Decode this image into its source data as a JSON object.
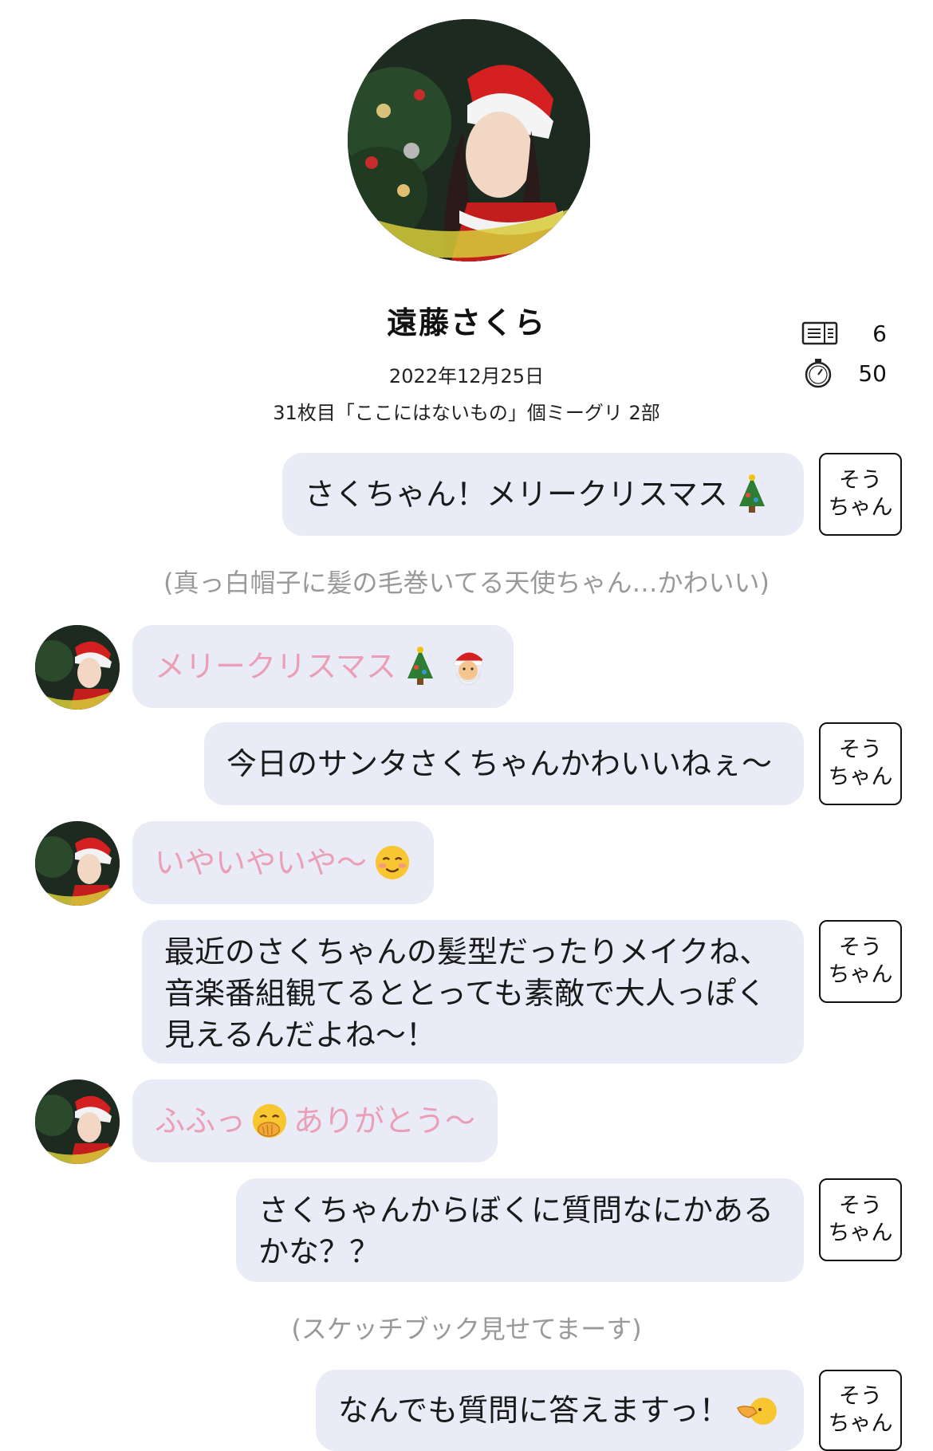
{
  "header": {
    "name": "遠藤さくら",
    "date": "2022年12月25日",
    "event": "31枚目「ここにはないもの」個ミーグリ 2部",
    "stats": [
      {
        "icon": "ticket-icon",
        "value": "6"
      },
      {
        "icon": "stopwatch-icon",
        "value": "50"
      }
    ]
  },
  "messages": [
    {
      "type": "self",
      "text": "さくちゃん！メリークリスマス",
      "emoji": "christmas-tree-icon",
      "sender": [
        "そう",
        "ちゃん"
      ]
    },
    {
      "type": "note",
      "text": "(真っ白帽子に髪の毛巻いてる天使ちゃん…かわいい)"
    },
    {
      "type": "other",
      "text": "メリークリスマス",
      "emoji": "christmas-tree-icon santa-icon"
    },
    {
      "type": "self",
      "text": "今日のサンタさくちゃんかわいいねぇ〜",
      "sender": [
        "そう",
        "ちゃん"
      ]
    },
    {
      "type": "other",
      "text": "いやいやいや〜",
      "emoji": "smiling-face-icon"
    },
    {
      "type": "self",
      "text": "最近のさくちゃんの髪型だったりメイクね、音楽番組観てるととっても素敵で大人っぽく見えるんだよね〜！",
      "sender": [
        "そう",
        "ちゃん"
      ]
    },
    {
      "type": "other",
      "text_a": "ふふっ",
      "emoji": "hand-over-mouth-icon",
      "text_b": "ありがとう〜"
    },
    {
      "type": "self",
      "text": "さくちゃんからぼくに質問なにかあるかな？？",
      "sender": [
        "そう",
        "ちゃん"
      ]
    },
    {
      "type": "note",
      "text": "(スケッチブック見せてまーす)"
    },
    {
      "type": "self",
      "text": "なんでも質問に答えますっ！",
      "emoji": "pointing-face-icon",
      "sender": [
        "そう",
        "ちゃん"
      ]
    }
  ]
}
